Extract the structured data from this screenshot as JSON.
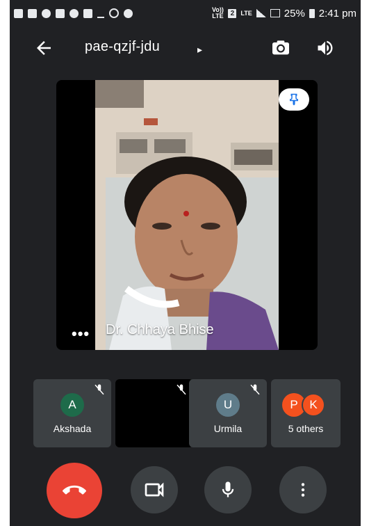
{
  "status_bar": {
    "left_icons": [
      "video-icon",
      "chat-icon",
      "whatsapp-icon",
      "facebook-icon",
      "snowflake-icon",
      "gallery-icon",
      "download-icon",
      "clock-icon",
      "heart-icon"
    ],
    "volte_label": "Vo)) LTE",
    "sim_label": "2",
    "lte_label": "LTE",
    "battery": "25%",
    "time": "2:41 pm"
  },
  "header": {
    "meeting_code": "pae-qzjf-jdu",
    "caret": "▸"
  },
  "main_video": {
    "speaker_name": "Dr. Chhaya Bhise",
    "more_label": "•••"
  },
  "participants": [
    {
      "initial": "A",
      "name": "Akshada",
      "avatar_color": "#1e6b4a",
      "muted": true
    },
    {
      "initial": "",
      "name": "",
      "avatar_color": "#000000",
      "muted": true
    },
    {
      "initial": "U",
      "name": "Urmila",
      "avatar_color": "#5f7c8a",
      "muted": true
    },
    {
      "initials": [
        "P",
        "K"
      ],
      "name": "5 others",
      "avatar_colors": [
        "#f4511e",
        "#f4511e"
      ]
    }
  ],
  "colors": {
    "background": "#202124",
    "end_call": "#ea4335",
    "control": "#3c4043",
    "pin_button": "#ffffff",
    "pin_icon": "#1a73e8"
  }
}
